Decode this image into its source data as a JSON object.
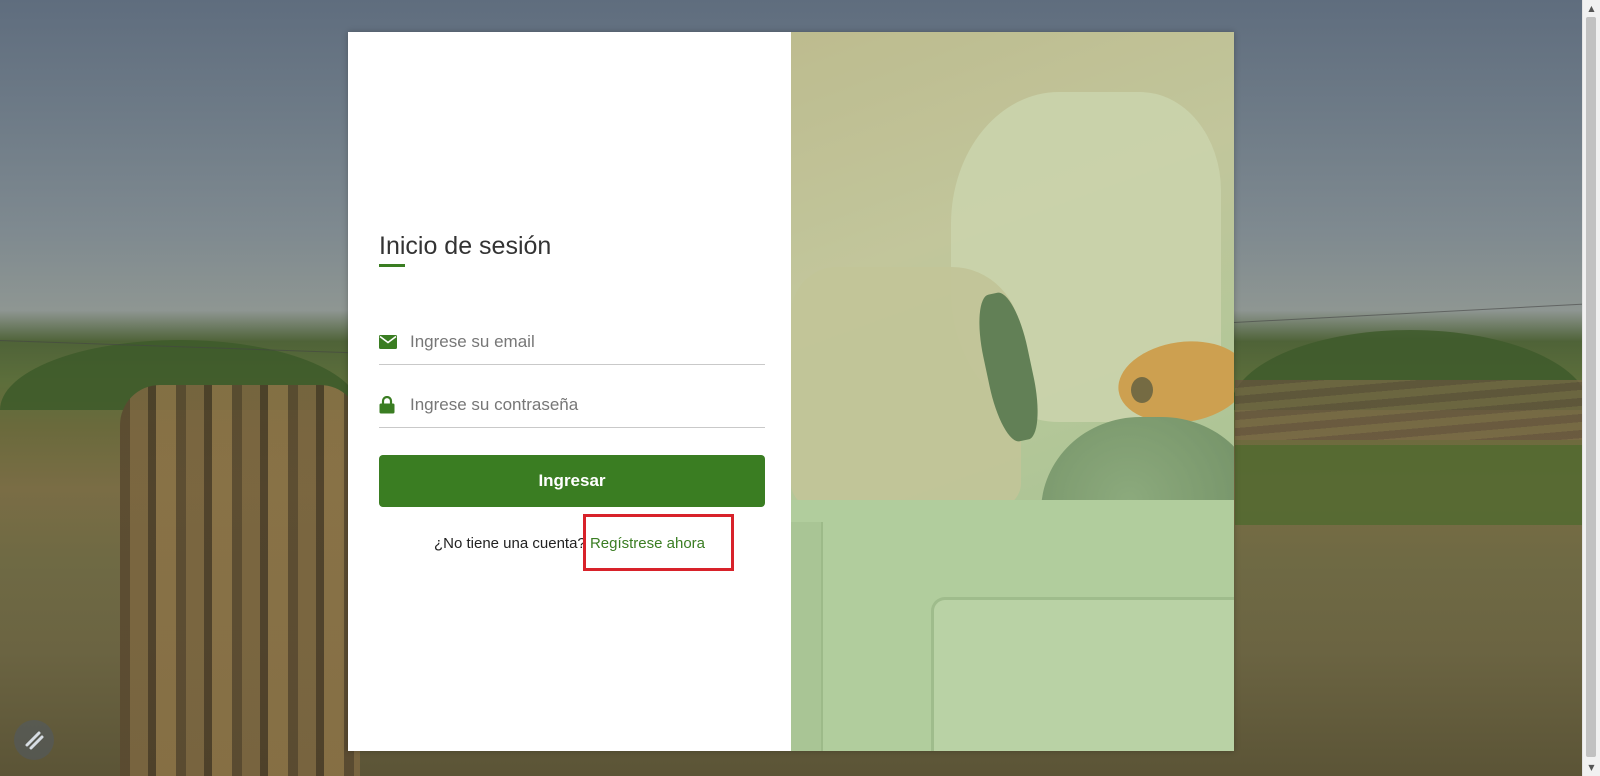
{
  "login": {
    "title": "Inicio de sesión",
    "email_placeholder": "Ingrese su email",
    "password_placeholder": "Ingrese su contraseña",
    "submit_label": "Ingresar",
    "no_account_text": "¿No tiene una cuenta?",
    "register_link": "Regístrese ahora"
  },
  "icons": {
    "email": "envelope-icon",
    "password": "lock-icon",
    "corner": "app-logo-icon"
  },
  "colors": {
    "accent": "#3a7d22",
    "highlight": "#d8222a",
    "text_dark": "#333333",
    "placeholder": "#777777"
  }
}
